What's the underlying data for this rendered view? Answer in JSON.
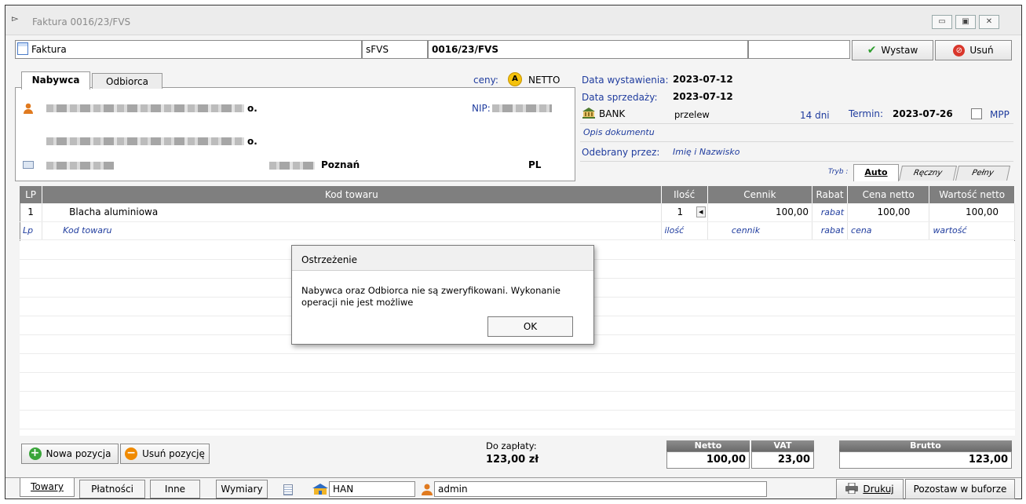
{
  "window": {
    "title": "Faktura 0016/23/FVS",
    "controls": [
      "▭",
      "▣",
      "✕"
    ]
  },
  "toolbar": {
    "doc_type": "Faktura",
    "series": "sFVS",
    "number": "0016/23/FVS",
    "issue_label": "Wystaw",
    "delete_label": "Usuń"
  },
  "party": {
    "tab_buyer": "Nabywca",
    "tab_recipient": "Odbiorca",
    "prices_label": "ceny:",
    "prices_badge": "A",
    "prices_mode": "NETTO",
    "line1_suffix": "o.",
    "line2_suffix": "o.",
    "nip_label": "NIP:",
    "city": "Poznań",
    "country": "PL"
  },
  "dates": {
    "issue_label": "Data wystawienia:",
    "issue_value": "2023-07-12",
    "sale_label": "Data sprzedaży:",
    "sale_value": "2023-07-12",
    "bank_label": "BANK",
    "payment_method": "przelew",
    "days": "14 dni",
    "due_label": "Termin:",
    "due_value": "2023-07-26",
    "mpp_label": "MPP",
    "doc_desc": "Opis dokumentu",
    "received_label": "Odebrany przez:",
    "received_value": "Imię i Nazwisko"
  },
  "modes": {
    "label": "Tryb :",
    "tabs": [
      "Auto",
      "Ręczny",
      "Pełny"
    ]
  },
  "grid": {
    "headers": [
      "LP",
      "Kod towaru",
      "Ilość",
      "Cennik",
      "Rabat",
      "Cena netto",
      "Wartość netto"
    ],
    "row1": [
      "1",
      "Blacha aluminiowa",
      "1",
      "100,00",
      "rabat",
      "100,00",
      "100,00"
    ],
    "placeholders": [
      "Lp",
      "Kod towaru",
      "ilość",
      "cennik",
      "rabat",
      "cena",
      "wartość"
    ]
  },
  "dialog": {
    "title": "Ostrzeżenie",
    "message": "Nabywca oraz Odbiorca nie są zweryfikowani. Wykonanie operacji nie jest możliwe",
    "ok_label": "OK"
  },
  "footer": {
    "new_position": "Nowa pozycja",
    "remove_position": "Usuń pozycję",
    "due_label": "Do zapłaty:",
    "due_amount": "123,00 zł",
    "netto_label": "Netto",
    "netto_value": "100,00",
    "vat_label": "VAT",
    "vat_value": "23,00",
    "brutto_label": "Brutto",
    "brutto_value": "123,00"
  },
  "bottom": {
    "tabs": [
      "Towary",
      "Płatności",
      "Inne",
      "Wymiary"
    ],
    "warehouse": "HAN",
    "user": "admin",
    "print_label": "Drukuj",
    "buffer_label": "Pozostaw w buforze"
  },
  "colors": {
    "grid_header": "#7f7f7f",
    "link_blue": "#1f3c9e",
    "issue_check": "#2e9e2e",
    "delete_red": "#d9362b",
    "add_green": "#3aa53a",
    "remove_orange": "#f08a00"
  }
}
